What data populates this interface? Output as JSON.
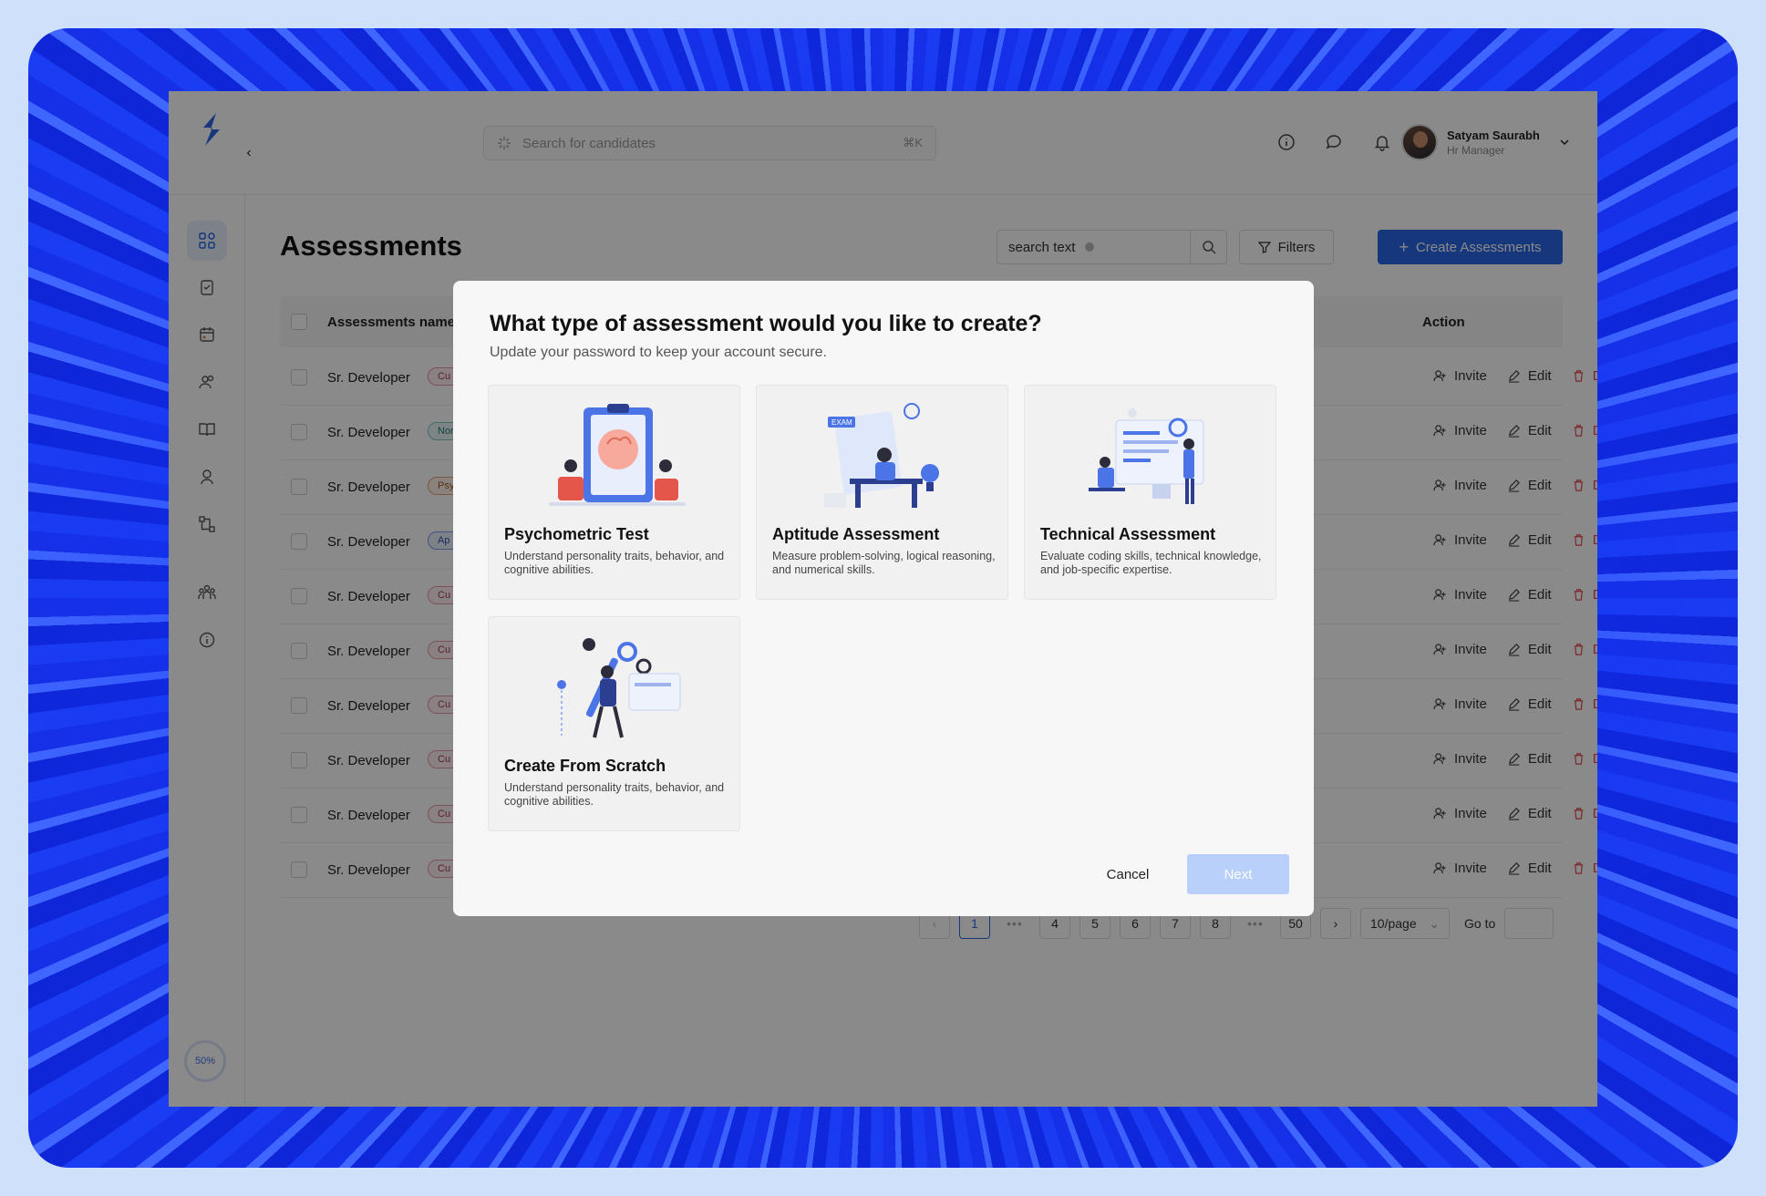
{
  "header": {
    "search_placeholder": "Search for candidates",
    "search_shortcut": "⌘K",
    "user_name": "Satyam Saurabh",
    "user_role": "Hr Manager"
  },
  "sidebar": {
    "progress_label": "50%",
    "icons": [
      "dashboard-icon",
      "clipboard-check-icon",
      "calendar-icon",
      "users-icon",
      "book-icon",
      "interviewer-icon",
      "workflow-icon",
      "team-icon",
      "info-icon"
    ]
  },
  "page": {
    "title": "Assessments",
    "search_value": "search text",
    "filters_label": "Filters",
    "create_label": "Create Assessments",
    "col_name": "Assessments name",
    "col_action": "Action"
  },
  "rows": [
    {
      "name": "Sr. Developer",
      "tag": "Cu",
      "tag_color": "pink"
    },
    {
      "name": "Sr. Developer",
      "tag": "Nor",
      "tag_color": "teal"
    },
    {
      "name": "Sr. Developer",
      "tag": "Psy",
      "tag_color": "orange"
    },
    {
      "name": "Sr. Developer",
      "tag": "Ap",
      "tag_color": "blue"
    },
    {
      "name": "Sr. Developer",
      "tag": "Cu",
      "tag_color": "pink"
    },
    {
      "name": "Sr. Developer",
      "tag": "Cu",
      "tag_color": "pink"
    },
    {
      "name": "Sr. Developer",
      "tag": "Cu",
      "tag_color": "pink"
    },
    {
      "name": "Sr. Developer",
      "tag": "Cu",
      "tag_color": "pink"
    },
    {
      "name": "Sr. Developer",
      "tag": "Cu",
      "tag_color": "pink"
    },
    {
      "name": "Sr. Developer",
      "tag": "Cu",
      "tag_color": "pink"
    }
  ],
  "actions": {
    "invite": "Invite",
    "edit": "Edit",
    "delete": "Delete"
  },
  "pagination": {
    "pages": [
      "1",
      "4",
      "5",
      "6",
      "7",
      "8",
      "50"
    ],
    "page_size": "10/page",
    "goto_label": "Go to"
  },
  "modal": {
    "title": "What type of assessment would you like to create?",
    "subtitle": "Update your password to keep your account secure.",
    "cards": [
      {
        "title": "Psychometric Test",
        "desc": "Understand personality traits, behavior, and cognitive abilities."
      },
      {
        "title": "Aptitude Assessment",
        "desc": "Measure problem-solving, logical reasoning, and numerical skills."
      },
      {
        "title": "Technical Assessment",
        "desc": "Evaluate coding skills, technical knowledge, and job-specific expertise."
      },
      {
        "title": "Create From Scratch",
        "desc": "Understand personality traits, behavior, and cognitive abilities."
      }
    ],
    "exam_label": "EXAM",
    "cancel_label": "Cancel",
    "next_label": "Next"
  },
  "colors": {
    "primary": "#2b66e8",
    "danger": "#e5484d",
    "next_disabled": "#b9d0fb"
  }
}
